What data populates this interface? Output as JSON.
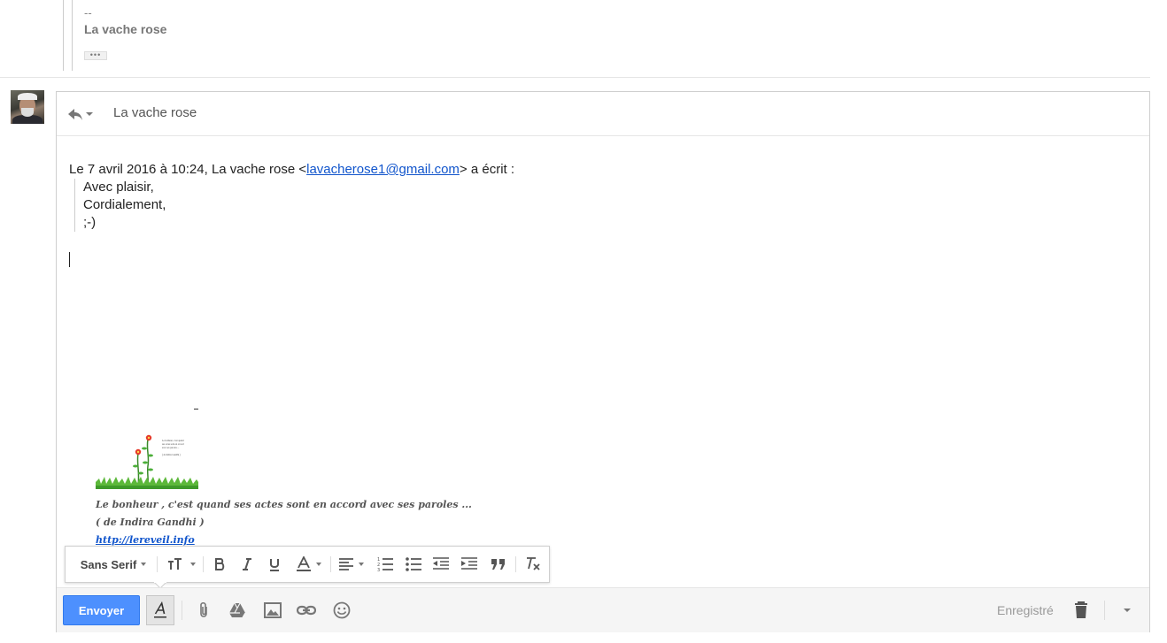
{
  "previous_message": {
    "signature_dash": "--",
    "signature_name": "La vache rose",
    "ellipsis": "•••"
  },
  "compose": {
    "recipient": "La vache rose",
    "quote_header_prefix": "Le 7 avril 2016 à 10:24, La vache rose <",
    "quote_email": "lavacherose1@gmail.com",
    "quote_header_suffix": "> a écrit :",
    "quoted_lines": [
      "Avec plaisir,",
      "Cordialement,",
      ";-)"
    ],
    "signature": {
      "quote_line": "Le bonheur , c'est quand ses actes sont en accord avec ses paroles ...",
      "author_line": "( de Indira Gandhi )",
      "link": "http://lereveil.info",
      "image_caption_lines": [
        "Le bonheur, c'est quand",
        "ses actes sont en accord",
        "avec ses paroles ...",
        "( de Indira Gandhi )"
      ]
    }
  },
  "format_toolbar": {
    "font_name": "Sans Serif"
  },
  "bottom_bar": {
    "send_label": "Envoyer",
    "saved_status": "Enregistré"
  },
  "colors": {
    "send_button": "#4d90fe",
    "link": "#1155cc"
  }
}
